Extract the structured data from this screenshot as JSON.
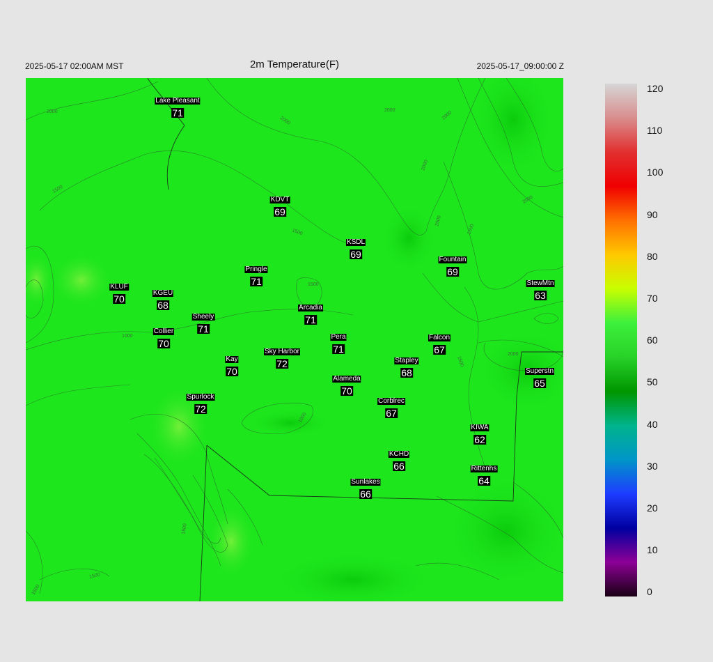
{
  "header": {
    "local_time": "2025-05-17 02:00AM MST",
    "title": "2m Temperature(F)",
    "utc_time": "2025-05-17_09:00:00 Z"
  },
  "map": {
    "background_color": "#1de61d",
    "contour_labels": [
      "2000",
      "2000",
      "2000",
      "2000",
      "1500",
      "2000",
      "1500",
      "1500",
      "1500",
      "2000",
      "2000",
      "1000",
      "1500",
      "2000",
      "1000",
      "1500",
      "1500",
      "1500"
    ]
  },
  "stations": [
    {
      "name": "Lake Pleasant",
      "temp": "71"
    },
    {
      "name": "KDVT",
      "temp": "69"
    },
    {
      "name": "KSDL",
      "temp": "69"
    },
    {
      "name": "Fountain",
      "temp": "69"
    },
    {
      "name": "Pringle",
      "temp": "71"
    },
    {
      "name": "KLUF",
      "temp": "70"
    },
    {
      "name": "KGEU",
      "temp": "68"
    },
    {
      "name": "StewMtn",
      "temp": "63"
    },
    {
      "name": "Arcadia",
      "temp": "71"
    },
    {
      "name": "Sheely",
      "temp": "71"
    },
    {
      "name": "Collier",
      "temp": "70"
    },
    {
      "name": "Pera",
      "temp": "71"
    },
    {
      "name": "Falcon",
      "temp": "67"
    },
    {
      "name": "Sky Harbor",
      "temp": "72"
    },
    {
      "name": "Kay",
      "temp": "70"
    },
    {
      "name": "Stapley",
      "temp": "68"
    },
    {
      "name": "Superstn",
      "temp": "65"
    },
    {
      "name": "Alameda",
      "temp": "70"
    },
    {
      "name": "Spurlock",
      "temp": "72"
    },
    {
      "name": "Corblrec",
      "temp": "67"
    },
    {
      "name": "KIWA",
      "temp": "62"
    },
    {
      "name": "KCHD",
      "temp": "66"
    },
    {
      "name": "Rittenhs",
      "temp": "64"
    },
    {
      "name": "Sunlakes",
      "temp": "66"
    }
  ],
  "colorbar": {
    "ticks": [
      "120",
      "110",
      "100",
      "90",
      "80",
      "70",
      "60",
      "50",
      "40",
      "30",
      "20",
      "10",
      "0"
    ],
    "colors_top_to_bottom": [
      "#d6d6d6",
      "#d98d8d",
      "#e23030",
      "#f00000",
      "#ff7000",
      "#ffc800",
      "#c8ff00",
      "#3cf03c",
      "#28d228",
      "#009600",
      "#00b48c",
      "#0096c8",
      "#1e3cff",
      "#0000a0",
      "#8c0096",
      "#1a0014"
    ]
  }
}
